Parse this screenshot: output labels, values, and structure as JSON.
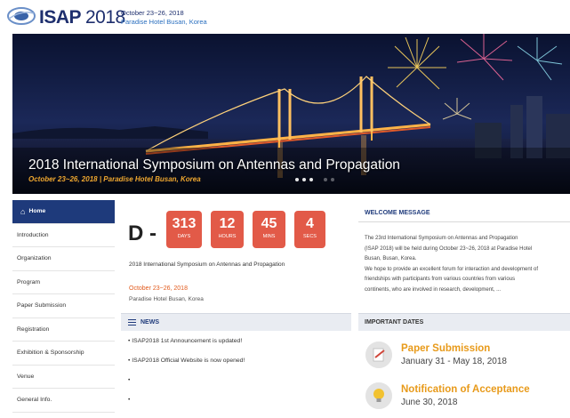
{
  "header": {
    "logo_word": "ISAP",
    "logo_year": "2018",
    "date_line": "October 23~26, 2018",
    "venue_line": "Paradise Hotel Busan, Korea"
  },
  "hero": {
    "title": "2018 International Symposium on Antennas and Propagation",
    "subtitle": "October 23~26, 2018  |  Paradise Hotel Busan, Korea",
    "active_slide": 2
  },
  "sidebar": {
    "items": [
      {
        "label": "Home"
      },
      {
        "label": "Introduction"
      },
      {
        "label": "Organization"
      },
      {
        "label": "Program"
      },
      {
        "label": "Paper Submission"
      },
      {
        "label": "Registration"
      },
      {
        "label": "Exhibition & Sponsorship"
      },
      {
        "label": "Venue"
      },
      {
        "label": "General Info."
      }
    ]
  },
  "countdown": {
    "prefix": "D -",
    "boxes": [
      {
        "value": "313",
        "label": "DAYS"
      },
      {
        "value": "12",
        "label": "HOURS"
      },
      {
        "value": "45",
        "label": "MINS"
      },
      {
        "value": "4",
        "label": "SECS"
      }
    ],
    "event_name": "2018 International Symposium on Antennas and Propagation",
    "event_date": "October 23~26, 2018",
    "event_venue": "Paradise Hotel Busan, Korea"
  },
  "news": {
    "title": "NEWS",
    "items": [
      "• ISAP2018 1st Announcement is updated!",
      "• ISAP2018 Official Website is now opened!",
      "•",
      "•"
    ]
  },
  "welcome": {
    "title": "WELCOME MESSAGE",
    "body": "The 23rd International Symposium on Antennas and Propagation\n(ISAP 2018) will be held during October 23~26, 2018 at Paradise Hotel\nBusan, Busan, Korea.\nWe hope to provide an excellent forum for interaction and development of\nfriendships with participants from various countries from various\ncontinents, who are involved in research, development, ..."
  },
  "important_dates": {
    "title": "IMPORTANT DATES",
    "items": [
      {
        "title": "Paper Submission",
        "date": "January 31 - May 18, 2018",
        "icon": "paper-submission-icon"
      },
      {
        "title": "Notification of Acceptance",
        "date": "June 30, 2018",
        "icon": "lightbulb-icon"
      }
    ]
  },
  "colors": {
    "brand_navy": "#1e3a7b",
    "countdown_red": "#e25a48",
    "date_orange": "#e89a1a"
  }
}
